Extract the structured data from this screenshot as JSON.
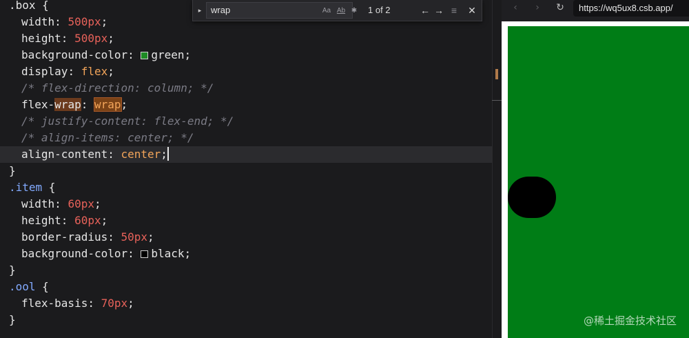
{
  "editor": {
    "lines": [
      {
        "segments": [
          {
            "c": "t-sel",
            "t": ".box"
          },
          {
            "c": "t-punc",
            "t": " {"
          }
        ]
      },
      {
        "indent": true,
        "segments": [
          {
            "c": "t-prop",
            "t": "width"
          },
          {
            "c": "t-punc",
            "t": ": "
          },
          {
            "c": "t-num",
            "t": "500px"
          },
          {
            "c": "t-punc",
            "t": ";"
          }
        ]
      },
      {
        "indent": true,
        "segments": [
          {
            "c": "t-prop",
            "t": "height"
          },
          {
            "c": "t-punc",
            "t": ": "
          },
          {
            "c": "t-num",
            "t": "500px"
          },
          {
            "c": "t-punc",
            "t": ";"
          }
        ]
      },
      {
        "indent": true,
        "segments": [
          {
            "c": "t-prop",
            "t": "background-color"
          },
          {
            "c": "t-punc",
            "t": ": "
          },
          {
            "swatch": "#1e8a24"
          },
          {
            "c": "t-punc",
            "t": "green;"
          }
        ]
      },
      {
        "indent": true,
        "segments": [
          {
            "c": "t-prop",
            "t": "display"
          },
          {
            "c": "t-punc",
            "t": ": "
          },
          {
            "c": "t-kw",
            "t": "flex"
          },
          {
            "c": "t-punc",
            "t": ";"
          }
        ]
      },
      {
        "indent": true,
        "segments": [
          {
            "c": "t-com",
            "t": "/* flex-direction: column; */"
          }
        ]
      },
      {
        "indent": true,
        "segments": [
          {
            "c": "t-prop",
            "t": "flex-"
          },
          {
            "c": "t-prop t-match",
            "t": "wrap"
          },
          {
            "c": "t-punc",
            "t": ": "
          },
          {
            "c": "t-kw t-match-cur",
            "t": "wrap"
          },
          {
            "c": "t-punc",
            "t": ";"
          }
        ]
      },
      {
        "indent": true,
        "segments": [
          {
            "c": "t-com",
            "t": "/* justify-content: flex-end; */"
          }
        ]
      },
      {
        "indent": true,
        "segments": [
          {
            "c": "t-com",
            "t": "/* align-items: center; */"
          }
        ]
      },
      {
        "indent": true,
        "active": true,
        "segments": [
          {
            "c": "t-prop",
            "t": "align-content"
          },
          {
            "c": "t-punc",
            "t": ": "
          },
          {
            "c": "t-kw",
            "t": "center"
          },
          {
            "c": "t-punc",
            "t": ";"
          },
          {
            "caret": true
          }
        ]
      },
      {
        "segments": [
          {
            "c": "t-punc",
            "t": "}"
          }
        ]
      },
      {
        "segments": [
          {
            "c": "t-cls",
            "t": ".item"
          },
          {
            "c": "t-punc",
            "t": " {"
          }
        ]
      },
      {
        "indent": true,
        "segments": [
          {
            "c": "t-prop",
            "t": "width"
          },
          {
            "c": "t-punc",
            "t": ": "
          },
          {
            "c": "t-num",
            "t": "60px"
          },
          {
            "c": "t-punc",
            "t": ";"
          }
        ]
      },
      {
        "indent": true,
        "segments": [
          {
            "c": "t-prop",
            "t": "height"
          },
          {
            "c": "t-punc",
            "t": ": "
          },
          {
            "c": "t-num",
            "t": "60px"
          },
          {
            "c": "t-punc",
            "t": ";"
          }
        ]
      },
      {
        "indent": true,
        "segments": [
          {
            "c": "t-prop",
            "t": "border-radius"
          },
          {
            "c": "t-punc",
            "t": ": "
          },
          {
            "c": "t-num",
            "t": "50px"
          },
          {
            "c": "t-punc",
            "t": ";"
          }
        ]
      },
      {
        "indent": true,
        "segments": [
          {
            "c": "t-prop",
            "t": "background-color"
          },
          {
            "c": "t-punc",
            "t": ": "
          },
          {
            "swatch": "#000000"
          },
          {
            "c": "t-punc",
            "t": "black;"
          }
        ]
      },
      {
        "segments": [
          {
            "c": "t-punc",
            "t": "}"
          }
        ]
      },
      {
        "segments": [
          {
            "c": "t-cls",
            "t": ".ool"
          },
          {
            "c": "t-punc",
            "t": " {"
          }
        ]
      },
      {
        "indent": true,
        "segments": [
          {
            "c": "t-prop",
            "t": "flex-basis"
          },
          {
            "c": "t-punc",
            "t": ": "
          },
          {
            "c": "t-num",
            "t": "70px"
          },
          {
            "c": "t-punc",
            "t": ";"
          }
        ]
      },
      {
        "segments": [
          {
            "c": "t-punc",
            "t": "}"
          }
        ]
      }
    ]
  },
  "find": {
    "toggle_icon": "▸",
    "query": "wrap",
    "match_case_label": "Aa",
    "whole_word_label": "Ab",
    "regex_label": "✱",
    "count": "1 of 2",
    "prev_icon": "←",
    "next_icon": "→",
    "selection_icon": "≡",
    "close_icon": "✕"
  },
  "browser": {
    "back_icon": "‹",
    "forward_icon": "›",
    "reload_icon": "↻",
    "url": "https://wq5ux8.csb.app/",
    "watermark": "@稀土掘金技术社区"
  },
  "colors": {
    "preview_bg": "#007d16",
    "item_bg": "#000000"
  }
}
